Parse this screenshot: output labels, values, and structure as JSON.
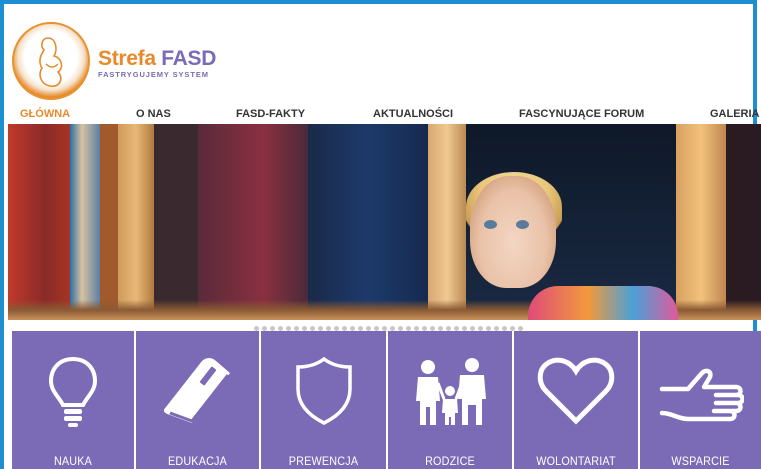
{
  "brand": {
    "name_part1": "Strefa",
    "name_part2": "FASD",
    "tagline": "FASTRYGUJEMY SYSTEM"
  },
  "nav": {
    "items": [
      {
        "label": "GŁÓWNA",
        "active": true
      },
      {
        "label": "O NAS",
        "active": false
      },
      {
        "label": "FASD-FAKTY",
        "active": false
      },
      {
        "label": "AKTUALNOŚCI",
        "active": false
      },
      {
        "label": "FASCYNUJĄCE FORUM",
        "active": false
      },
      {
        "label": "GALERIA",
        "active": false
      }
    ]
  },
  "tiles": [
    {
      "label": "NAUKA",
      "icon": "lightbulb-icon"
    },
    {
      "label": "EDUKACJA",
      "icon": "book-icon"
    },
    {
      "label": "PREWENCJA",
      "icon": "shield-icon"
    },
    {
      "label": "RODZICE",
      "icon": "family-icon"
    },
    {
      "label": "WOLONTARIAT",
      "icon": "heart-icon"
    },
    {
      "label": "WSPARCIE",
      "icon": "helping-hand-icon"
    }
  ],
  "colors": {
    "accent_orange": "#e88a2c",
    "brand_purple": "#7b6bb6",
    "frame_blue": "#1d8fd0"
  }
}
